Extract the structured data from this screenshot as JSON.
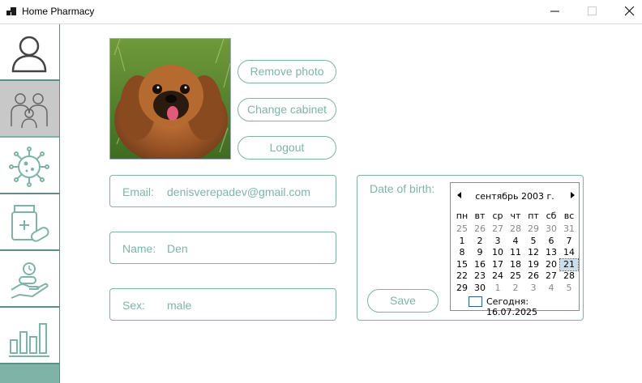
{
  "window": {
    "title": "Home Pharmacy"
  },
  "sidebar": {
    "items": [
      {
        "icon": "user-icon"
      },
      {
        "icon": "family-icon"
      },
      {
        "icon": "virus-icon"
      },
      {
        "icon": "medicine-icon"
      },
      {
        "icon": "pill-hand-icon"
      },
      {
        "icon": "bar-chart-icon"
      }
    ],
    "active_index": 1
  },
  "profile": {
    "remove_photo_label": "Remove photo",
    "change_cabinet_label": "Change cabinet",
    "logout_label": "Logout",
    "email_label": "Email:",
    "email_value": "denisverepadev@gmail.com",
    "name_label": "Name:",
    "name_value": "Den",
    "sex_label": "Sex:",
    "sex_value": "male",
    "dob_label": "Date of birth:",
    "save_label": "Save"
  },
  "calendar": {
    "month_title": "сентябрь 2003 г.",
    "weekdays": [
      "пн",
      "вт",
      "ср",
      "чт",
      "пт",
      "сб",
      "вс"
    ],
    "weeks": [
      [
        "25",
        "26",
        "27",
        "28",
        "29",
        "30",
        "31"
      ],
      [
        "1",
        "2",
        "3",
        "4",
        "5",
        "6",
        "7"
      ],
      [
        "8",
        "9",
        "10",
        "11",
        "12",
        "13",
        "14"
      ],
      [
        "15",
        "16",
        "17",
        "18",
        "19",
        "20",
        "21"
      ],
      [
        "22",
        "23",
        "24",
        "25",
        "26",
        "27",
        "28"
      ],
      [
        "29",
        "30",
        "1",
        "2",
        "3",
        "4",
        "5"
      ]
    ],
    "selected_day": "21",
    "today_text": "Сегодня: 16.07.2025"
  },
  "colors": {
    "accent": "#7fb3a7",
    "border": "#5a8f84"
  }
}
